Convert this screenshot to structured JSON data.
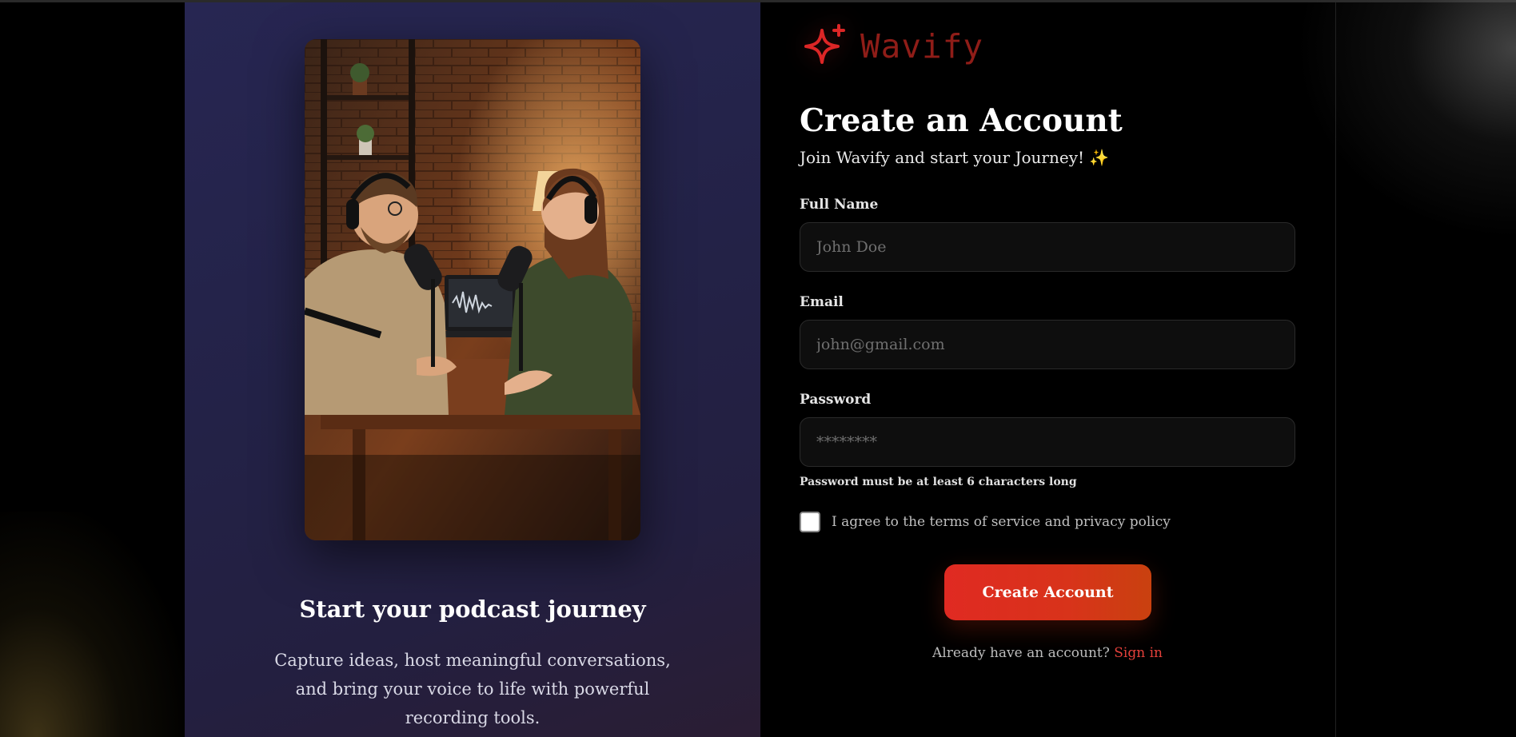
{
  "brand": {
    "name": "Wavify",
    "accent_color": "#dc2626",
    "logo_icon": "sparkle-icon"
  },
  "left_panel": {
    "heading": "Start your podcast journey",
    "description": "Capture ideas, host meaningful conversations, and bring your voice to life with powerful recording tools.",
    "image": "podcast-hosts-photo"
  },
  "form": {
    "title": "Create an Account",
    "subtitle": "Join Wavify and start your Journey!",
    "subtitle_emoji": "✨",
    "full_name": {
      "label": "Full Name",
      "placeholder": "John Doe",
      "value": ""
    },
    "email": {
      "label": "Email",
      "placeholder": "john@gmail.com",
      "value": ""
    },
    "password": {
      "label": "Password",
      "placeholder": "********",
      "value": ""
    },
    "password_hint": "Password must be at least 6 characters long",
    "terms_label": "I agree to the terms of service and privacy policy",
    "terms_checked": false,
    "submit_label": "Create Account",
    "signin_prompt": "Already have an account?",
    "signin_link": "Sign in"
  }
}
